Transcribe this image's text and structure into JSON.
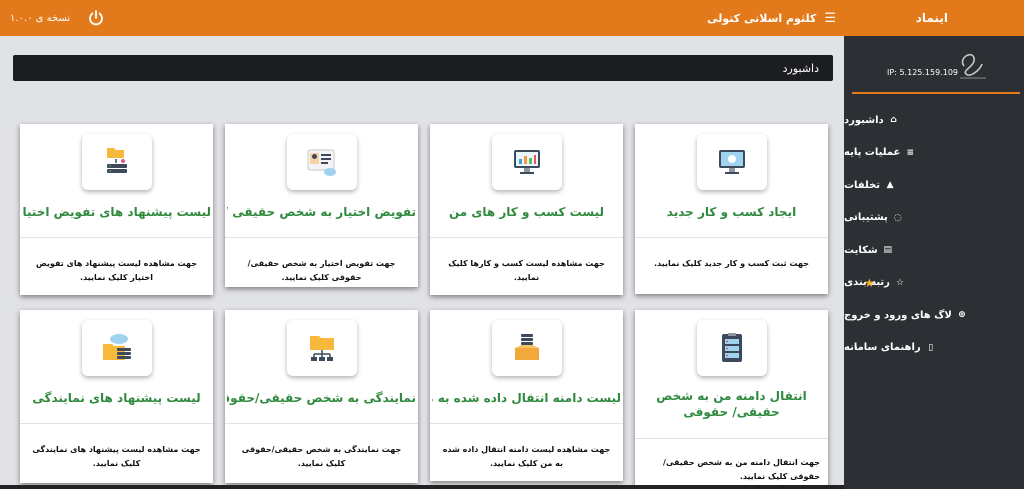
{
  "header": {
    "brand": "اینماد",
    "user_name": "کلثوم اسلانی کتولی",
    "version": "نسخه ی ۱.۰.۰"
  },
  "sidebar": {
    "ip": "IP: 5.125.159.109",
    "items": [
      {
        "label": "داشبورد",
        "icon": "home-icon",
        "has_submenu": false
      },
      {
        "label": "عملیات پایه",
        "icon": "list-icon",
        "has_submenu": true
      },
      {
        "label": "تخلفات",
        "icon": "warning-icon",
        "has_submenu": false
      },
      {
        "label": "پشتیبانی",
        "icon": "chat-icon",
        "has_submenu": true
      },
      {
        "label": "شکایت",
        "icon": "document-icon",
        "has_submenu": false
      },
      {
        "label": "رتبه بندی",
        "icon": "star-icon",
        "has_submenu": false
      },
      {
        "label": "لاگ های ورود و خروج",
        "icon": "plus-circle-icon",
        "has_submenu": false
      },
      {
        "label": "راهنمای سامانه",
        "icon": "file-icon",
        "has_submenu": true
      }
    ]
  },
  "breadcrumb": "داشبورد",
  "cards": [
    {
      "title": "ایجاد کسب و کار جدید",
      "description": "جهت ثبت کسب و کار جدید کلیک نمایید.",
      "icon": "computer-upload-icon"
    },
    {
      "title": "لیست کسب و کار های من",
      "description": "جهت مشاهده لیست کسب و کارها کلیک نمایید.",
      "icon": "monitor-chart-icon"
    },
    {
      "title": "تفویض اختیار به شخص حقیقی / حقوقی",
      "description": "جهت تفویض اختیار به شخص حقیقی/حقوقی کلیک نمایید.",
      "icon": "id-card-cloud-icon"
    },
    {
      "title": "لیست پیشنهاد های تفویض اختیار",
      "description": "جهت مشاهده لیست پیشنهاد های تفویض اختیار کلیک نمایید.",
      "icon": "folder-server-icon"
    },
    {
      "title": "انتقال دامنه من به شخص حقیقی/ حقوقی",
      "description": "جهت انتقال دامنه من به شخص حقیقی/حقوقی کلیک نمایید.",
      "icon": "clipboard-server-icon"
    },
    {
      "title": "لیست دامنه انتقال داده شده به من",
      "description": "جهت مشاهده لیست دامنه انتقال داده شده به من کلیک نمایید.",
      "icon": "box-server-icon"
    },
    {
      "title": "نمایندگی به شخص حقیقی/حقوقی",
      "description": "جهت نمایندگی به شخص حقیقی/حقوقی کلیک نمایید.",
      "icon": "folder-network-icon"
    },
    {
      "title": "لیست پیشنهاد های نمایندگی",
      "description": "جهت مشاهده لیست پیشنهاد های نمایندگی کلیک نمایید.",
      "icon": "folder-cloud-icon"
    }
  ],
  "colors": {
    "header_bg": "#e27a1b",
    "sidebar_bg": "#2c2f33",
    "title_green": "#2f8a3e",
    "breadcrumb_bg": "#1b1d20",
    "star": "#f0b323"
  }
}
